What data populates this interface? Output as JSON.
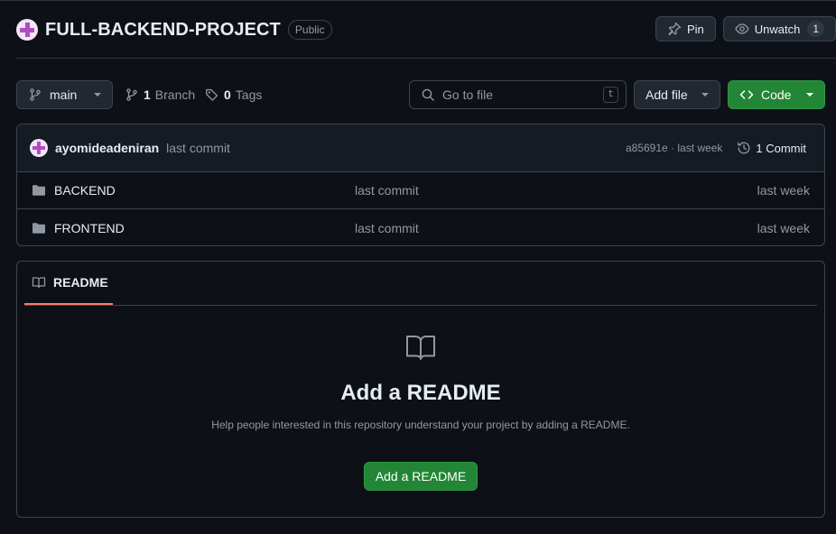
{
  "repo": {
    "name": "FULL-BACKEND-PROJECT",
    "visibility": "Public",
    "pin_label": "Pin",
    "unwatch_label": "Unwatch",
    "watch_count": "1"
  },
  "toolbar": {
    "branch": "main",
    "branch_count": "1",
    "branch_label": "Branch",
    "tag_count": "0",
    "tag_label": "Tags",
    "search_placeholder": "Go to file",
    "search_shortcut": "t",
    "add_file_label": "Add file",
    "code_label": "Code"
  },
  "latest_commit": {
    "author": "ayomideadeniran",
    "message": "last commit",
    "hash_and_time": "a85691e · last week",
    "commits_label": "1 Commit"
  },
  "files": [
    {
      "name": "BACKEND",
      "type": "folder",
      "message": "last commit",
      "date": "last week"
    },
    {
      "name": "FRONTEND",
      "type": "folder",
      "message": "last commit",
      "date": "last week"
    }
  ],
  "readme": {
    "tab_label": "README",
    "title": "Add a README",
    "description": "Help people interested in this repository understand your project by adding a README.",
    "button_label": "Add a README"
  },
  "colors": {
    "background": "#0d1117",
    "border": "#3d444d",
    "muted_text": "#9198a1",
    "primary_button": "#238636",
    "tab_underline": "#f78166"
  }
}
